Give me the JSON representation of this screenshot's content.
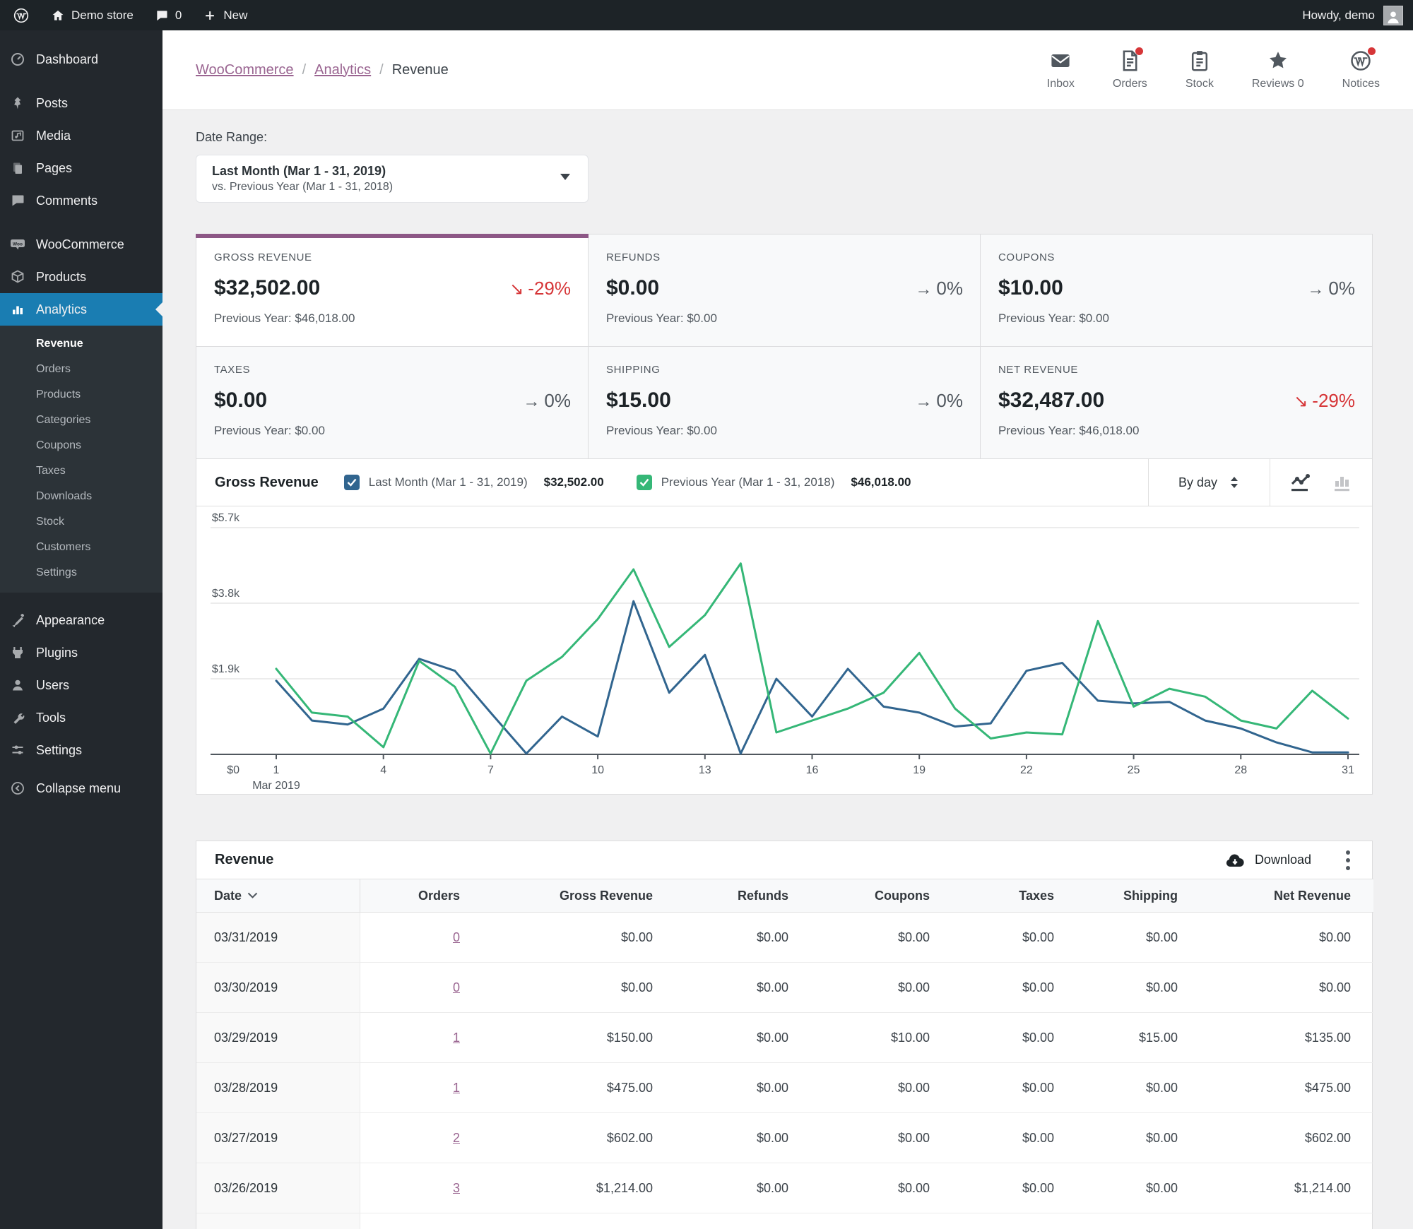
{
  "admin_bar": {
    "site_name": "Demo store",
    "comment_count": "0",
    "new_label": "New",
    "howdy": "Howdy, demo"
  },
  "sidebar": {
    "items": [
      {
        "label": "Dashboard",
        "icon": "dashboard-icon"
      },
      {
        "sep": true
      },
      {
        "label": "Posts",
        "icon": "posts-icon"
      },
      {
        "label": "Media",
        "icon": "media-icon"
      },
      {
        "label": "Pages",
        "icon": "pages-icon"
      },
      {
        "label": "Comments",
        "icon": "comments-icon"
      },
      {
        "sep": true
      },
      {
        "label": "WooCommerce",
        "icon": "woocommerce-icon"
      },
      {
        "label": "Products",
        "icon": "products-icon"
      },
      {
        "label": "Analytics",
        "icon": "analytics-icon",
        "active": true,
        "submenu": [
          {
            "label": "Revenue",
            "active": true
          },
          {
            "label": "Orders"
          },
          {
            "label": "Products"
          },
          {
            "label": "Categories"
          },
          {
            "label": "Coupons"
          },
          {
            "label": "Taxes"
          },
          {
            "label": "Downloads"
          },
          {
            "label": "Stock"
          },
          {
            "label": "Customers"
          },
          {
            "label": "Settings"
          }
        ]
      },
      {
        "sep": true
      },
      {
        "label": "Appearance",
        "icon": "appearance-icon"
      },
      {
        "label": "Plugins",
        "icon": "plugins-icon"
      },
      {
        "label": "Users",
        "icon": "users-icon"
      },
      {
        "label": "Tools",
        "icon": "tools-icon"
      },
      {
        "label": "Settings",
        "icon": "settings-icon"
      },
      {
        "spacer": true
      },
      {
        "label": "Collapse menu",
        "icon": "collapse-icon"
      }
    ]
  },
  "header": {
    "breadcrumb": [
      {
        "label": "WooCommerce",
        "link": true
      },
      {
        "label": "Analytics",
        "link": true
      },
      {
        "label": "Revenue",
        "link": false
      }
    ],
    "activity": [
      {
        "label": "Inbox",
        "icon": "inbox-icon",
        "badge": false
      },
      {
        "label": "Orders",
        "icon": "orders-icon",
        "badge": true
      },
      {
        "label": "Stock",
        "icon": "stock-icon",
        "badge": false
      },
      {
        "label": "Reviews 0",
        "icon": "reviews-star-icon",
        "badge": false
      },
      {
        "label": "Notices",
        "icon": "notices-wp-icon",
        "badge": true
      }
    ]
  },
  "date_range": {
    "label": "Date Range:",
    "selected": "Last Month (Mar 1 - 31, 2019)",
    "compare": "vs. Previous Year (Mar 1 - 31, 2018)"
  },
  "summary": [
    {
      "label": "GROSS REVENUE",
      "value": "$32,502.00",
      "trend_arrow": "↘",
      "trend": "-29%",
      "trend_dir": "down",
      "previous": "Previous Year: $46,018.00",
      "selected": true
    },
    {
      "label": "REFUNDS",
      "value": "$0.00",
      "trend_arrow": "→",
      "trend": "0%",
      "trend_dir": "flat",
      "previous": "Previous Year: $0.00",
      "selected": false
    },
    {
      "label": "COUPONS",
      "value": "$10.00",
      "trend_arrow": "→",
      "trend": "0%",
      "trend_dir": "flat",
      "previous": "Previous Year: $0.00",
      "selected": false
    },
    {
      "label": "TAXES",
      "value": "$0.00",
      "trend_arrow": "→",
      "trend": "0%",
      "trend_dir": "flat",
      "previous": "Previous Year: $0.00",
      "selected": false
    },
    {
      "label": "SHIPPING",
      "value": "$15.00",
      "trend_arrow": "→",
      "trend": "0%",
      "trend_dir": "flat",
      "previous": "Previous Year: $0.00",
      "selected": false
    },
    {
      "label": "NET REVENUE",
      "value": "$32,487.00",
      "trend_arrow": "↘",
      "trend": "-29%",
      "trend_dir": "down",
      "previous": "Previous Year: $46,018.00",
      "selected": false
    }
  ],
  "chart": {
    "title": "Gross Revenue",
    "interval": "By day",
    "legend": [
      {
        "label": "Last Month (Mar 1 - 31, 2019)",
        "value": "$32,502.00",
        "color": "#31658f"
      },
      {
        "label": "Previous Year (Mar 1 - 31, 2018)",
        "value": "$46,018.00",
        "color": "#35b777"
      }
    ]
  },
  "chart_data": {
    "type": "line",
    "title": "Gross Revenue",
    "interval": "By day",
    "x": [
      1,
      2,
      3,
      4,
      5,
      6,
      7,
      8,
      9,
      10,
      11,
      12,
      13,
      14,
      15,
      16,
      17,
      18,
      19,
      20,
      21,
      22,
      23,
      24,
      25,
      26,
      27,
      28,
      29,
      30,
      31
    ],
    "x_tick_labels": [
      "1",
      "4",
      "7",
      "10",
      "13",
      "16",
      "19",
      "22",
      "25",
      "28",
      "31"
    ],
    "x_axis_sub_label": "Mar 2019",
    "y_ticks": [
      {
        "label": "$0",
        "value": 0
      },
      {
        "label": "$1.9k",
        "value": 1900
      },
      {
        "label": "$3.8k",
        "value": 3800
      },
      {
        "label": "$5.7k",
        "value": 5700
      }
    ],
    "ylim": [
      0,
      6200
    ],
    "grid": "horizontal",
    "legend_position": "header",
    "series": [
      {
        "name": "Last Month (Mar 1 - 31, 2019)",
        "color": "#31658f",
        "total": "$32,502.00",
        "values": [
          1850,
          850,
          750,
          1150,
          2400,
          2100,
          1050,
          20,
          950,
          450,
          3850,
          1550,
          2500,
          20,
          1900,
          950,
          2150,
          1200,
          1050,
          700,
          780,
          2100,
          2300,
          1350,
          1280,
          1320,
          850,
          650,
          300,
          50,
          50
        ]
      },
      {
        "name": "Previous Year (Mar 1 - 31, 2018)",
        "color": "#35b777",
        "total": "$46,018.00",
        "values": [
          2150,
          1050,
          950,
          180,
          2350,
          1700,
          20,
          1850,
          2450,
          3400,
          4650,
          2700,
          3500,
          4800,
          550,
          850,
          1150,
          1550,
          2550,
          1150,
          400,
          550,
          500,
          3350,
          1200,
          1650,
          1450,
          850,
          650,
          1600,
          900
        ]
      }
    ]
  },
  "table": {
    "title": "Revenue",
    "download_label": "Download",
    "columns": [
      "Date",
      "Orders",
      "Gross Revenue",
      "Refunds",
      "Coupons",
      "Taxes",
      "Shipping",
      "Net Revenue"
    ],
    "rows": [
      [
        "03/31/2019",
        "0",
        "$0.00",
        "$0.00",
        "$0.00",
        "$0.00",
        "$0.00",
        "$0.00"
      ],
      [
        "03/30/2019",
        "0",
        "$0.00",
        "$0.00",
        "$0.00",
        "$0.00",
        "$0.00",
        "$0.00"
      ],
      [
        "03/29/2019",
        "1",
        "$150.00",
        "$0.00",
        "$10.00",
        "$0.00",
        "$15.00",
        "$135.00"
      ],
      [
        "03/28/2019",
        "1",
        "$475.00",
        "$0.00",
        "$0.00",
        "$0.00",
        "$0.00",
        "$475.00"
      ],
      [
        "03/27/2019",
        "2",
        "$602.00",
        "$0.00",
        "$0.00",
        "$0.00",
        "$0.00",
        "$602.00"
      ],
      [
        "03/26/2019",
        "3",
        "$1,214.00",
        "$0.00",
        "$0.00",
        "$0.00",
        "$0.00",
        "$1,214.00"
      ]
    ]
  },
  "colors": {
    "active_menu": "#1a7db2",
    "accent_bar": "#8d5786",
    "link": "#9a6591",
    "negative": "#d63638",
    "chart_blue": "#31658f",
    "chart_green": "#35b777",
    "badge": "#d63638"
  }
}
